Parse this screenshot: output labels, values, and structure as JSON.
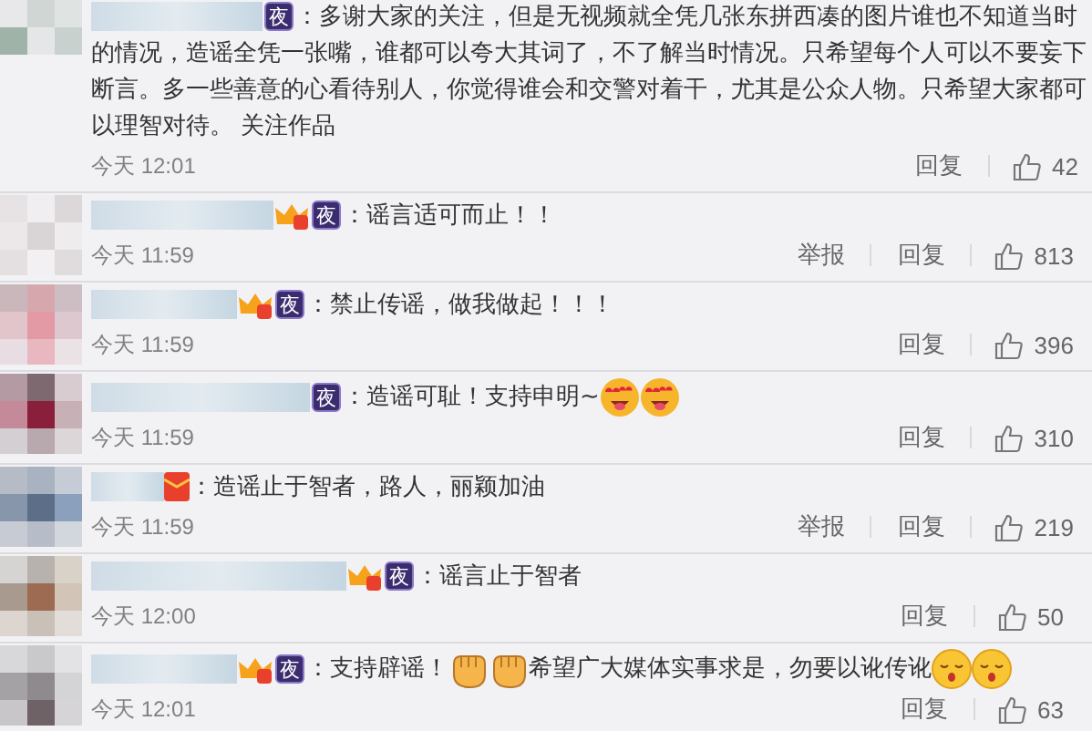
{
  "comments": [
    {
      "badges": [
        {
          "kind": "night",
          "text": "夜"
        }
      ],
      "content": [
        {
          "kind": "text",
          "text": "：多谢大家的关注，但是无视频就全凭几张东拼西凑的图片谁也不知道当时"
        },
        {
          "kind": "text_block",
          "text": "的情况，造谣全凭一张嘴，谁都可以夸大其词了，不了解当时情况。只希望每个人可以不要妄下断言。多一些善意的心看待别人，你觉得谁会和交警对着干，尤其是公众人物。只希望大家都可以理智对待。 关注作品"
        }
      ],
      "time": "今天 12:01",
      "actions": [
        "回复"
      ],
      "likes": "42"
    },
    {
      "badges": [
        {
          "kind": "crown"
        },
        {
          "kind": "night",
          "text": "夜"
        }
      ],
      "content": [
        {
          "kind": "text",
          "text": "：谣言适可而止！！"
        }
      ],
      "time": "今天 11:59",
      "actions": [
        "举报",
        "回复"
      ],
      "likes": "813"
    },
    {
      "badges": [
        {
          "kind": "crown"
        },
        {
          "kind": "night",
          "text": "夜"
        }
      ],
      "content": [
        {
          "kind": "text",
          "text": "：禁止传谣，做我做起！！！"
        }
      ],
      "time": "今天 11:59",
      "actions": [
        "回复"
      ],
      "likes": "396"
    },
    {
      "badges": [
        {
          "kind": "night",
          "text": "夜"
        }
      ],
      "content": [
        {
          "kind": "text",
          "text": "：造谣可耻！支持申明~"
        },
        {
          "kind": "heart_eyes"
        },
        {
          "kind": "heart_eyes"
        }
      ],
      "time": "今天 11:59",
      "actions": [
        "回复"
      ],
      "likes": "310"
    },
    {
      "badges": [
        {
          "kind": "redpacket"
        }
      ],
      "content": [
        {
          "kind": "text",
          "text": "：造谣止于智者，路人，丽颖加油"
        }
      ],
      "time": "今天 11:59",
      "actions": [
        "举报",
        "回复"
      ],
      "likes": "219"
    },
    {
      "badges": [
        {
          "kind": "crown"
        },
        {
          "kind": "night",
          "text": "夜"
        }
      ],
      "content": [
        {
          "kind": "text",
          "text": "：谣言止于智者"
        }
      ],
      "time": "今天 12:00",
      "actions": [
        "回复"
      ],
      "likes": "50"
    },
    {
      "badges": [
        {
          "kind": "crown"
        },
        {
          "kind": "night",
          "text": "夜"
        }
      ],
      "content": [
        {
          "kind": "text",
          "text": "：支持辟谣！"
        },
        {
          "kind": "fist"
        },
        {
          "kind": "fist"
        },
        {
          "kind": "text",
          "text": "希望广大媒体实事求是，勿要以讹传讹"
        },
        {
          "kind": "kiss"
        },
        {
          "kind": "kiss"
        }
      ],
      "time": "今天 12:01",
      "actions": [
        "回复"
      ],
      "likes": "63"
    }
  ]
}
